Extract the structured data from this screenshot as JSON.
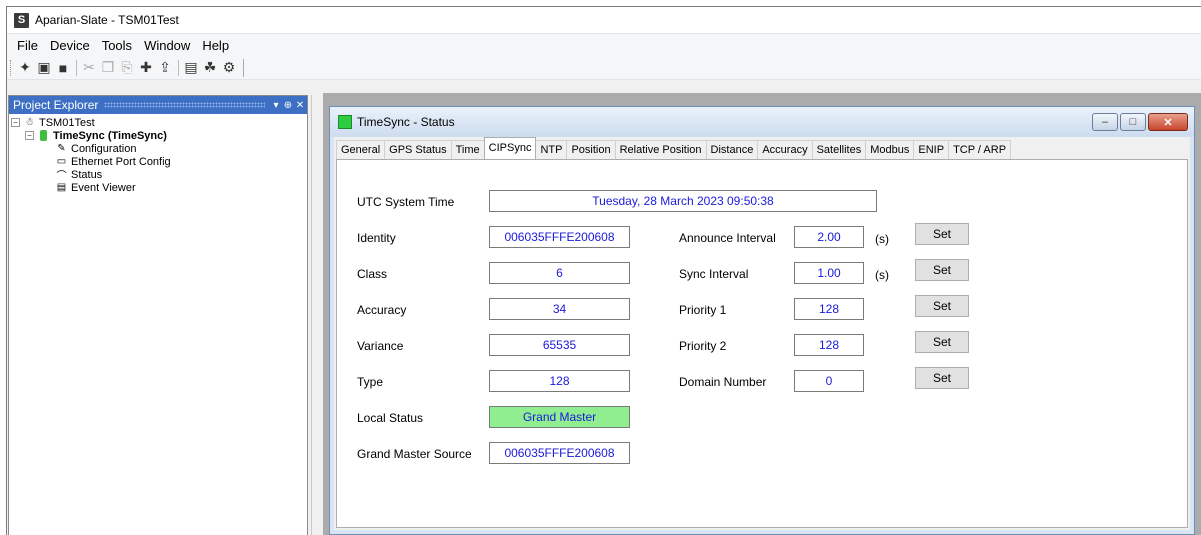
{
  "app": {
    "title": "Aparian-Slate  - TSM01Test",
    "icon_letter": "S"
  },
  "menu": [
    "File",
    "Device",
    "Tools",
    "Window",
    "Help"
  ],
  "toolbar_icons": [
    "new-icon",
    "open-icon",
    "save-icon",
    "cut-icon",
    "copy-icon",
    "paste-icon",
    "add-icon",
    "upload-icon",
    "monitor-icon",
    "network-icon",
    "settings-icon"
  ],
  "explorer": {
    "title": "Project Explorer",
    "pin_glyph": "▾ ⊕ ✕",
    "tree": {
      "root": "TSM01Test",
      "device": "TimeSync (TimeSync)",
      "children": [
        "Configuration",
        "Ethernet Port Config",
        "Status",
        "Event Viewer"
      ]
    }
  },
  "window": {
    "title": "TimeSync - Status",
    "tabs": [
      "General",
      "GPS Status",
      "Time",
      "CIPSync",
      "NTP",
      "Position",
      "Relative Position",
      "Distance",
      "Accuracy",
      "Satellites",
      "Modbus",
      "ENIP",
      "TCP / ARP"
    ],
    "active_tab": "CIPSync"
  },
  "cipsync": {
    "utc_label": "UTC System Time",
    "utc_value": "Tuesday, 28 March 2023 09:50:38",
    "left": [
      {
        "label": "Identity",
        "value": "006035FFFE200608"
      },
      {
        "label": "Class",
        "value": "6"
      },
      {
        "label": "Accuracy",
        "value": "34"
      },
      {
        "label": "Variance",
        "value": "65535"
      },
      {
        "label": "Type",
        "value": "128"
      },
      {
        "label": "Local Status",
        "value": "Grand Master"
      },
      {
        "label": "Grand Master Source",
        "value": "006035FFFE200608"
      }
    ],
    "right": [
      {
        "label": "Announce Interval",
        "value": "2.00",
        "unit": "(s)",
        "button": "Set"
      },
      {
        "label": "Sync Interval",
        "value": "1.00",
        "unit": "(s)",
        "button": "Set"
      },
      {
        "label": "Priority 1",
        "value": "128",
        "unit": "",
        "button": "Set"
      },
      {
        "label": "Priority 2",
        "value": "128",
        "unit": "",
        "button": "Set"
      },
      {
        "label": "Domain Number",
        "value": "0",
        "unit": "",
        "button": "Set"
      }
    ]
  },
  "colors": {
    "explorer_header": "#3d6fc4",
    "value_text": "#1a1adb",
    "grand_master_bg": "#90ee90",
    "status_green": "#2ecc40"
  }
}
